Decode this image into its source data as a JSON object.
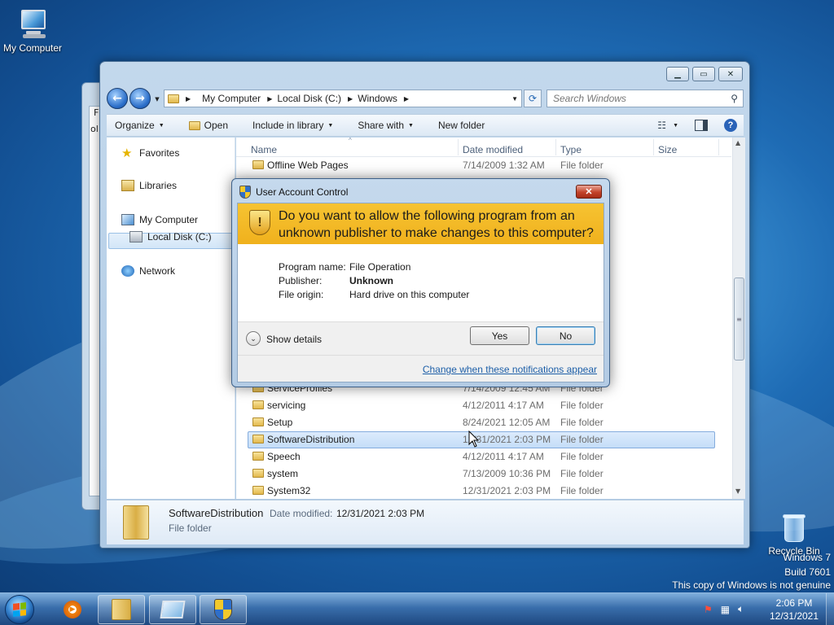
{
  "desktop": {
    "icons": {
      "my_computer": "My Computer",
      "recycle_bin": "Recycle Bin"
    },
    "watermark": {
      "line1": "Windows 7",
      "line2": "Build 7601",
      "line3": "This copy of Windows is not genuine"
    },
    "back_window": {
      "text1": "F",
      "text2": "ol"
    }
  },
  "explorer": {
    "address": {
      "crumbs": [
        "My Computer",
        "Local Disk (C:)",
        "Windows"
      ]
    },
    "search": {
      "placeholder": "Search Windows"
    },
    "toolbar": {
      "organize": "Organize",
      "open": "Open",
      "include_in_library": "Include in library",
      "share_with": "Share with",
      "new_folder": "New folder"
    },
    "nav": {
      "favorites": "Favorites",
      "libraries": "Libraries",
      "my_computer": "My Computer",
      "local_disk": "Local Disk (C:)",
      "network": "Network"
    },
    "columns": {
      "name": "Name",
      "date_modified": "Date modified",
      "type": "Type",
      "size": "Size"
    },
    "files": [
      {
        "name": "Offline Web Pages",
        "date": "7/14/2009 1:32 AM",
        "type": "File folder"
      },
      {
        "name": "ServiceProfiles",
        "date": "7/14/2009 12:45 AM",
        "type": "File folder"
      },
      {
        "name": "servicing",
        "date": "4/12/2011 4:17 AM",
        "type": "File folder"
      },
      {
        "name": "Setup",
        "date": "8/24/2021 12:05 AM",
        "type": "File folder"
      },
      {
        "name": "SoftwareDistribution",
        "date": "12/31/2021 2:03 PM",
        "type": "File folder"
      },
      {
        "name": "Speech",
        "date": "4/12/2011 4:17 AM",
        "type": "File folder"
      },
      {
        "name": "system",
        "date": "7/13/2009 10:36 PM",
        "type": "File folder"
      },
      {
        "name": "System32",
        "date": "12/31/2021 2:03 PM",
        "type": "File folder"
      }
    ],
    "details": {
      "name": "SoftwareDistribution",
      "date_label": "Date modified:",
      "date_value": "12/31/2021 2:03 PM",
      "type": "File folder"
    }
  },
  "uac": {
    "title": "User Account Control",
    "question": "Do you want to allow the following program from an unknown publisher to make changes to this computer?",
    "program_label": "Program name:",
    "program_value": "File Operation",
    "publisher_label": "Publisher:",
    "publisher_value": "Unknown",
    "origin_label": "File origin:",
    "origin_value": "Hard drive on this computer",
    "show_details": "Show details",
    "yes": "Yes",
    "no": "No",
    "change_link": "Change when these notifications appear"
  },
  "taskbar": {
    "clock_time": "2:06 PM",
    "clock_date": "12/31/2021"
  }
}
